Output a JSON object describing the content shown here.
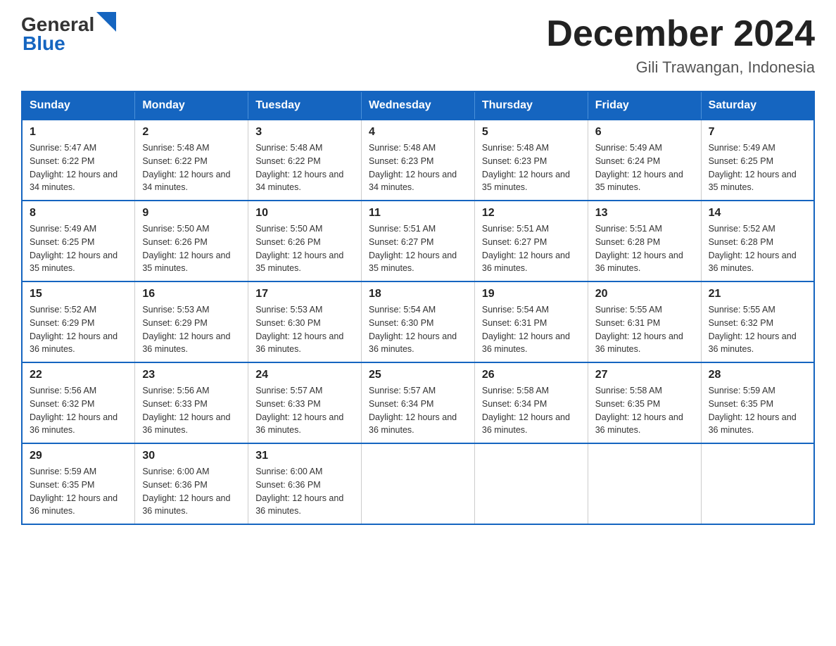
{
  "logo": {
    "text_general": "General",
    "text_blue": "Blue"
  },
  "header": {
    "title": "December 2024",
    "subtitle": "Gili Trawangan, Indonesia"
  },
  "days_of_week": [
    "Sunday",
    "Monday",
    "Tuesday",
    "Wednesday",
    "Thursday",
    "Friday",
    "Saturday"
  ],
  "weeks": [
    [
      {
        "day": "1",
        "sunrise": "5:47 AM",
        "sunset": "6:22 PM",
        "daylight": "12 hours and 34 minutes."
      },
      {
        "day": "2",
        "sunrise": "5:48 AM",
        "sunset": "6:22 PM",
        "daylight": "12 hours and 34 minutes."
      },
      {
        "day": "3",
        "sunrise": "5:48 AM",
        "sunset": "6:22 PM",
        "daylight": "12 hours and 34 minutes."
      },
      {
        "day": "4",
        "sunrise": "5:48 AM",
        "sunset": "6:23 PM",
        "daylight": "12 hours and 34 minutes."
      },
      {
        "day": "5",
        "sunrise": "5:48 AM",
        "sunset": "6:23 PM",
        "daylight": "12 hours and 35 minutes."
      },
      {
        "day": "6",
        "sunrise": "5:49 AM",
        "sunset": "6:24 PM",
        "daylight": "12 hours and 35 minutes."
      },
      {
        "day": "7",
        "sunrise": "5:49 AM",
        "sunset": "6:25 PM",
        "daylight": "12 hours and 35 minutes."
      }
    ],
    [
      {
        "day": "8",
        "sunrise": "5:49 AM",
        "sunset": "6:25 PM",
        "daylight": "12 hours and 35 minutes."
      },
      {
        "day": "9",
        "sunrise": "5:50 AM",
        "sunset": "6:26 PM",
        "daylight": "12 hours and 35 minutes."
      },
      {
        "day": "10",
        "sunrise": "5:50 AM",
        "sunset": "6:26 PM",
        "daylight": "12 hours and 35 minutes."
      },
      {
        "day": "11",
        "sunrise": "5:51 AM",
        "sunset": "6:27 PM",
        "daylight": "12 hours and 35 minutes."
      },
      {
        "day": "12",
        "sunrise": "5:51 AM",
        "sunset": "6:27 PM",
        "daylight": "12 hours and 36 minutes."
      },
      {
        "day": "13",
        "sunrise": "5:51 AM",
        "sunset": "6:28 PM",
        "daylight": "12 hours and 36 minutes."
      },
      {
        "day": "14",
        "sunrise": "5:52 AM",
        "sunset": "6:28 PM",
        "daylight": "12 hours and 36 minutes."
      }
    ],
    [
      {
        "day": "15",
        "sunrise": "5:52 AM",
        "sunset": "6:29 PM",
        "daylight": "12 hours and 36 minutes."
      },
      {
        "day": "16",
        "sunrise": "5:53 AM",
        "sunset": "6:29 PM",
        "daylight": "12 hours and 36 minutes."
      },
      {
        "day": "17",
        "sunrise": "5:53 AM",
        "sunset": "6:30 PM",
        "daylight": "12 hours and 36 minutes."
      },
      {
        "day": "18",
        "sunrise": "5:54 AM",
        "sunset": "6:30 PM",
        "daylight": "12 hours and 36 minutes."
      },
      {
        "day": "19",
        "sunrise": "5:54 AM",
        "sunset": "6:31 PM",
        "daylight": "12 hours and 36 minutes."
      },
      {
        "day": "20",
        "sunrise": "5:55 AM",
        "sunset": "6:31 PM",
        "daylight": "12 hours and 36 minutes."
      },
      {
        "day": "21",
        "sunrise": "5:55 AM",
        "sunset": "6:32 PM",
        "daylight": "12 hours and 36 minutes."
      }
    ],
    [
      {
        "day": "22",
        "sunrise": "5:56 AM",
        "sunset": "6:32 PM",
        "daylight": "12 hours and 36 minutes."
      },
      {
        "day": "23",
        "sunrise": "5:56 AM",
        "sunset": "6:33 PM",
        "daylight": "12 hours and 36 minutes."
      },
      {
        "day": "24",
        "sunrise": "5:57 AM",
        "sunset": "6:33 PM",
        "daylight": "12 hours and 36 minutes."
      },
      {
        "day": "25",
        "sunrise": "5:57 AM",
        "sunset": "6:34 PM",
        "daylight": "12 hours and 36 minutes."
      },
      {
        "day": "26",
        "sunrise": "5:58 AM",
        "sunset": "6:34 PM",
        "daylight": "12 hours and 36 minutes."
      },
      {
        "day": "27",
        "sunrise": "5:58 AM",
        "sunset": "6:35 PM",
        "daylight": "12 hours and 36 minutes."
      },
      {
        "day": "28",
        "sunrise": "5:59 AM",
        "sunset": "6:35 PM",
        "daylight": "12 hours and 36 minutes."
      }
    ],
    [
      {
        "day": "29",
        "sunrise": "5:59 AM",
        "sunset": "6:35 PM",
        "daylight": "12 hours and 36 minutes."
      },
      {
        "day": "30",
        "sunrise": "6:00 AM",
        "sunset": "6:36 PM",
        "daylight": "12 hours and 36 minutes."
      },
      {
        "day": "31",
        "sunrise": "6:00 AM",
        "sunset": "6:36 PM",
        "daylight": "12 hours and 36 minutes."
      },
      null,
      null,
      null,
      null
    ]
  ],
  "labels": {
    "sunrise_prefix": "Sunrise: ",
    "sunset_prefix": "Sunset: ",
    "daylight_prefix": "Daylight: "
  }
}
